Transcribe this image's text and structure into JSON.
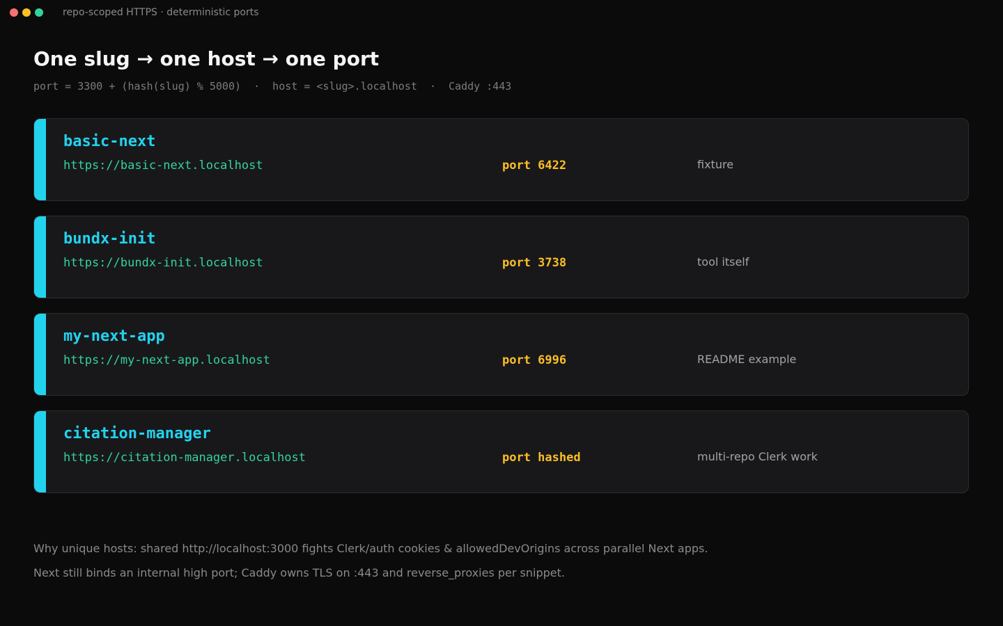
{
  "window": {
    "title": "repo-scoped HTTPS · deterministic ports"
  },
  "header": {
    "title": "One slug → one host → one port",
    "formula": "port = 3300 + (hash(slug) % 5000)  ·  host = <slug>.localhost  ·  Caddy :443"
  },
  "projects": [
    {
      "slug": "basic-next",
      "url": "https://basic-next.localhost",
      "port": "port 6422",
      "note": "fixture"
    },
    {
      "slug": "bundx-init",
      "url": "https://bundx-init.localhost",
      "port": "port 3738",
      "note": "tool itself"
    },
    {
      "slug": "my-next-app",
      "url": "https://my-next-app.localhost",
      "port": "port 6996",
      "note": "README example"
    },
    {
      "slug": "citation-manager",
      "url": "https://citation-manager.localhost",
      "port": "port hashed",
      "note": "multi-repo Clerk work"
    }
  ],
  "footer": {
    "line1": "Why unique hosts: shared http://localhost:3000 fights Clerk/auth cookies & allowedDevOrigins across parallel Next apps.",
    "line2": "Next still binds an internal high port; Caddy owns TLS on :443 and reverse_proxies per snippet."
  },
  "colors": {
    "accent": "#22d3ee",
    "url": "#34d399",
    "port": "#fbbf24",
    "background": "#0b0b0c",
    "card": "#18181b"
  }
}
